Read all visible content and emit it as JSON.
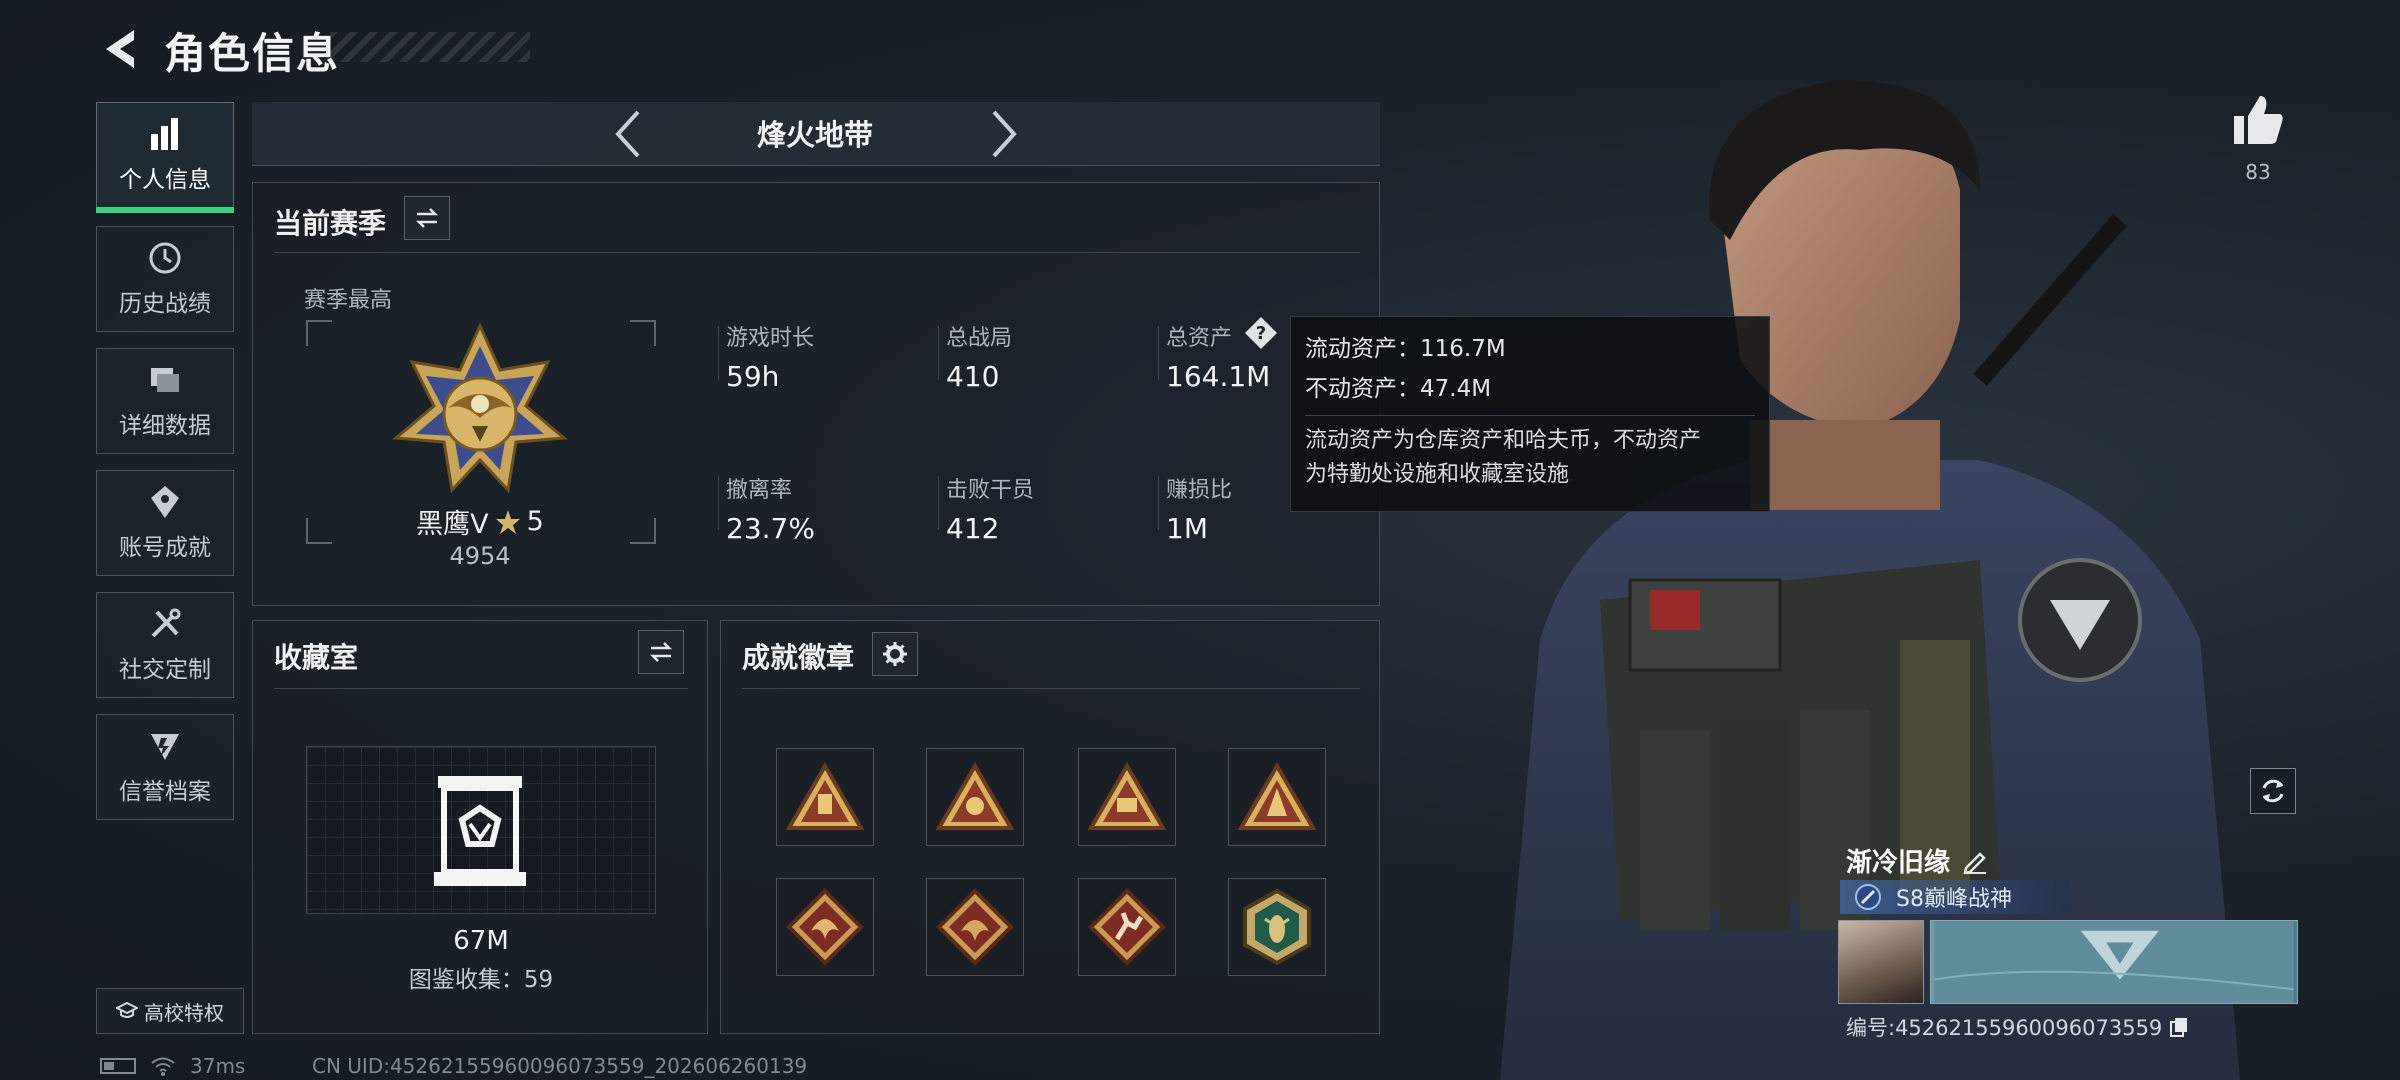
{
  "header": {
    "title": "角色信息",
    "back_icon": "back-arrow-icon"
  },
  "nav": {
    "items": [
      {
        "label": "个人信息",
        "icon": "bar-chart-icon",
        "active": true
      },
      {
        "label": "历史战绩",
        "icon": "history-clock-icon",
        "active": false
      },
      {
        "label": "详细数据",
        "icon": "folders-icon",
        "active": false
      },
      {
        "label": "账号成就",
        "icon": "achievement-icon",
        "active": false
      },
      {
        "label": "社交定制",
        "icon": "tools-icon",
        "active": false
      },
      {
        "label": "信誉档案",
        "icon": "credit-shield-icon",
        "active": false
      }
    ],
    "campus_label": "高校特权"
  },
  "status": {
    "ping": "37ms",
    "uid": "CN UID:4526215596009607355​9_202606260139"
  },
  "mode": {
    "title": "烽火地带"
  },
  "season": {
    "title": "当前赛季",
    "best_label": "赛季最高",
    "rank_name": "黑鹰V",
    "rank_stars": "5",
    "rank_score": "4954",
    "stats": [
      {
        "label": "游戏时长",
        "value": "59h"
      },
      {
        "label": "总战局",
        "value": "410"
      },
      {
        "label": "总资产",
        "value": "164.1M"
      },
      {
        "label": "撤离率",
        "value": "23.7%"
      },
      {
        "label": "击败干员",
        "value": "412"
      },
      {
        "label": "赚损比",
        "value": "1M"
      }
    ]
  },
  "tooltip": {
    "liquid": "流动资产：116.7M",
    "fixed": "不动资产：47.4M",
    "desc_line1": "流动资产为仓库资产和哈夫币，不动资产",
    "desc_line2": "为特勤处设施和收藏室设施"
  },
  "collection": {
    "title": "收藏室",
    "value": "67M",
    "count": "图鉴收集：59"
  },
  "badges": {
    "title": "成就徽章",
    "items": [
      "badge-triangle-1",
      "badge-triangle-2",
      "badge-triangle-3",
      "badge-triangle-4",
      "badge-dragon-1",
      "badge-dragon-2",
      "badge-runner",
      "badge-wasp"
    ]
  },
  "profile": {
    "likes": "83",
    "name": "渐冷旧缘",
    "title_tag": "S8巅峰战神",
    "player_id": "编号:4526215596009607355​9"
  }
}
